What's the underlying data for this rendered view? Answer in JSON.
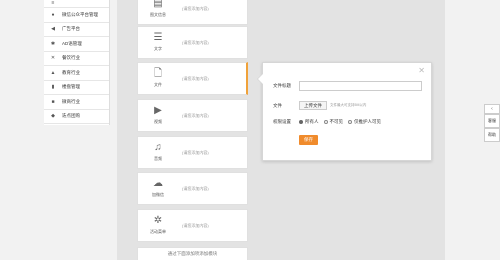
{
  "sidebar": {
    "items": [
      {
        "label": "",
        "icon": "menu-icon"
      },
      {
        "label": "微信公众平台管理",
        "icon": "chat-icon"
      },
      {
        "label": "广告平台",
        "icon": "megaphone-icon"
      },
      {
        "label": "AD语管理",
        "icon": "gear-icon"
      },
      {
        "label": "餐饮行业",
        "icon": "cutlery-icon"
      },
      {
        "label": "教育行业",
        "icon": "cap-icon"
      },
      {
        "label": "楼盘管理",
        "icon": "building-icon"
      },
      {
        "label": "微商行业",
        "icon": "shop-icon"
      },
      {
        "label": "迭点团购",
        "icon": "tag-icon"
      }
    ]
  },
  "items": [
    {
      "caption": "图文信息",
      "hint": "(请您添加内容)",
      "glyph": "▤"
    },
    {
      "caption": "文字",
      "hint": "(请您添加内容)",
      "glyph": "☰"
    },
    {
      "caption": "文件",
      "hint": "(请您添加内容)",
      "glyph": "🗋"
    },
    {
      "caption": "视频",
      "hint": "(请您添加内容)",
      "glyph": "▶"
    },
    {
      "caption": "音频",
      "hint": "(请您添加内容)",
      "glyph": "♫"
    },
    {
      "caption": "加微信",
      "hint": "(请您添加内容)",
      "glyph": "☁"
    },
    {
      "caption": "活动菜单",
      "hint": "(请您添加内容)",
      "glyph": "✲"
    }
  ],
  "add_row": "通过下面添加项添加模块",
  "popup": {
    "title_label": "文件标题",
    "file_label": "文件",
    "upload_label": "上传文件",
    "upload_tip": "文件最大可支持5M以内",
    "perm_label": "权限设置",
    "options": [
      "所有人",
      "不可见",
      "仅推护人可见"
    ],
    "selected": 0,
    "save_label": "保存"
  },
  "float_tabs": [
    "客服",
    "帮助"
  ],
  "colors": {
    "accent": "#f08b2c",
    "active_border": "#f0a23a"
  }
}
